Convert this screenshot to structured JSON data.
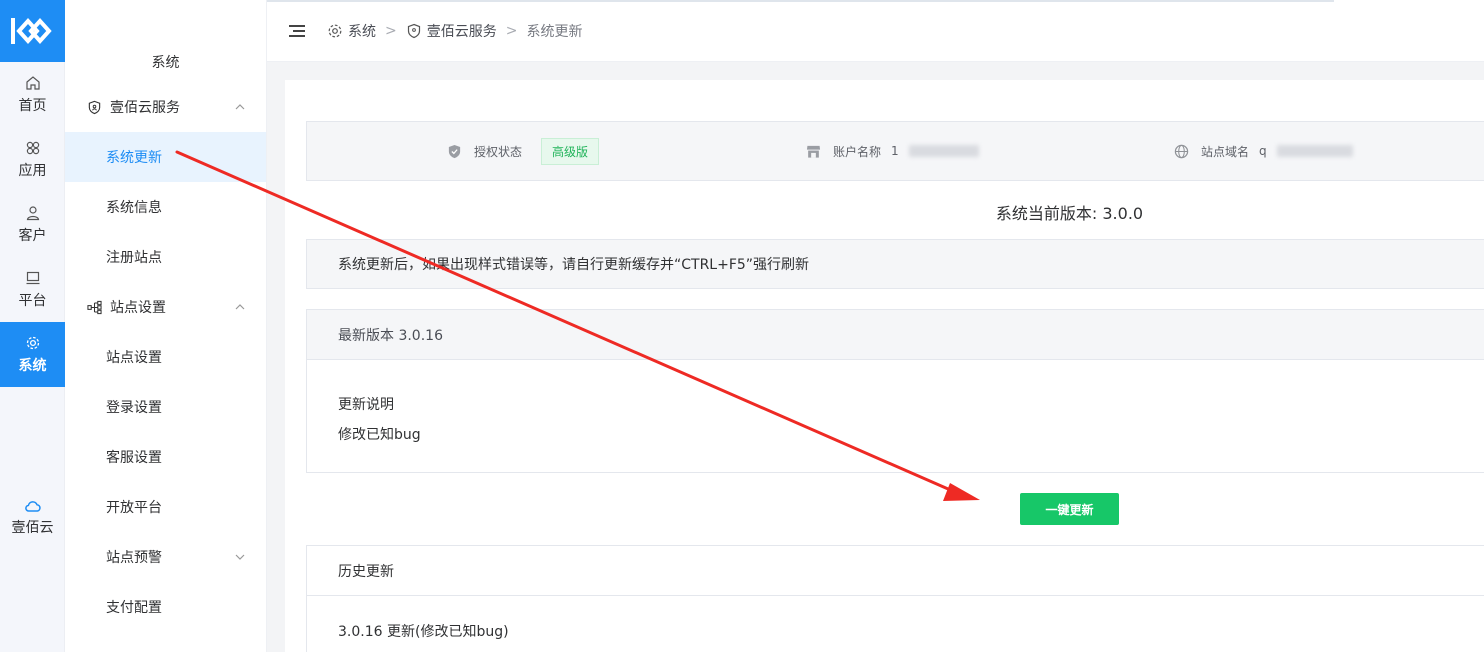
{
  "rail": {
    "items": [
      {
        "label": "首页",
        "icon": "home-icon"
      },
      {
        "label": "应用",
        "icon": "apps-icon"
      },
      {
        "label": "客户",
        "icon": "user-icon"
      },
      {
        "label": "平台",
        "icon": "monitor-icon"
      },
      {
        "label": "系统",
        "icon": "gear-icon"
      }
    ],
    "cloud_label": "壹佰云",
    "active_color": "#1e8df4"
  },
  "sidebar": {
    "title": "系统",
    "group1": {
      "label": "壹佰云服务",
      "items": [
        "系统更新",
        "系统信息",
        "注册站点"
      ]
    },
    "group2": {
      "label": "站点设置",
      "items": [
        "站点设置",
        "登录设置",
        "客服设置",
        "开放平台"
      ]
    },
    "group3": {
      "label": "站点预警",
      "items": [
        "支付配置"
      ]
    }
  },
  "breadcrumb": {
    "item1": "系统",
    "item2": "壹佰云服务",
    "item3": "系统更新",
    "sep": ">"
  },
  "info": {
    "license_label": "授权状态",
    "license_value": "高级版",
    "account_label": "账户名称",
    "account_value": "1",
    "domain_label": "站点域名",
    "domain_value": "q"
  },
  "current_version": "系统当前版本: 3.0.0",
  "notice": "系统更新后，如果出现样式错误等，请自行更新缓存并“CTRL+F5”强行刷新",
  "latest": {
    "title": "最新版本 3.0.16",
    "notes_label": "更新说明",
    "notes": "修改已知bug"
  },
  "update_button": "一键更新",
  "history": {
    "title": "历史更新",
    "rows": [
      "3.0.16 更新(修改已知bug)"
    ]
  },
  "colors": {
    "primary": "#1e8df4",
    "success": "#17c768",
    "annotation_arrow": "#ee2a24"
  }
}
